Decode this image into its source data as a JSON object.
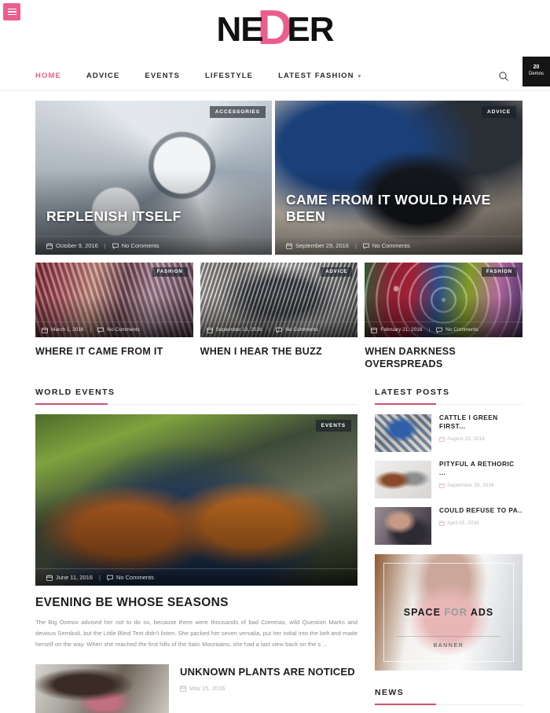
{
  "brand": {
    "logo_text": "NEDER",
    "logo_left": "NE",
    "logo_accent": "D",
    "logo_right": "ER",
    "accent_color": "#eb5e8c"
  },
  "topbar": {
    "menu_icon": "hamburger-icon",
    "demos_badge_count": "20",
    "demos_badge_label": "Demos"
  },
  "nav": {
    "items": [
      {
        "label": "HOME",
        "active": true
      },
      {
        "label": "ADVICE",
        "active": false
      },
      {
        "label": "EVENTS",
        "active": false
      },
      {
        "label": "LIFESTYLE",
        "active": false
      },
      {
        "label": "LATEST FASHION",
        "active": false,
        "has_dropdown": true
      }
    ],
    "search_icon": "search-icon"
  },
  "hero": [
    {
      "category": "ACCESSORIES",
      "title": "REPLENISH ITSELF",
      "date": "October 9, 2016",
      "comments": "No Comments"
    },
    {
      "category": "ADVICE",
      "title": "CAME FROM IT WOULD HAVE BEEN",
      "date": "September 29, 2016",
      "comments": "No Comments"
    }
  ],
  "trio": [
    {
      "category": "FASHION",
      "title": "WHERE IT CAME FROM IT",
      "date": "March 1, 2016",
      "comments": "No Comments"
    },
    {
      "category": "ADVICE",
      "title": "WHEN I HEAR THE BUZZ",
      "date": "September 13, 2016",
      "comments": "No Comments"
    },
    {
      "category": "FASHION",
      "title": "WHEN DARKNESS OVERSPREADS",
      "date": "February 21, 2016",
      "comments": "No Comments"
    }
  ],
  "world_events": {
    "heading": "WORLD EVENTS",
    "feature": {
      "category": "EVENTS",
      "title": "EVENING BE WHOSE SEASONS",
      "date": "June 11, 2016",
      "comments": "No Comments",
      "excerpt": "The Big Oxmox advised her not to do so, because there were thousands of bad Commas, wild Question Marks and devious Semikoli, but the Little Blind Text didn't listen. She packed her seven versalia, put her initial into the belt and made herself on the way. When she reached the first hills of the Italic Mountains, she had a last view back on the s ..."
    },
    "secondary": {
      "title": "UNKNOWN PLANTS ARE NOTICED",
      "date": "May 15, 2016"
    }
  },
  "sidebar": {
    "latest_posts_heading": "LATEST POSTS",
    "latest_posts": [
      {
        "title": "CATTLE I GREEN FIRST...",
        "date": "August 23, 2016"
      },
      {
        "title": "PITYFUL A RETHORIC ...",
        "date": "September 29, 2016"
      },
      {
        "title": "COULD REFUSE TO PA..",
        "date": "April 15, 2016"
      }
    ],
    "ad": {
      "line_bold_1": "SPACE",
      "line_muted": "FOR",
      "line_bold_2": "ADS",
      "caption": "BANNER"
    },
    "news_heading": "NEWS"
  }
}
